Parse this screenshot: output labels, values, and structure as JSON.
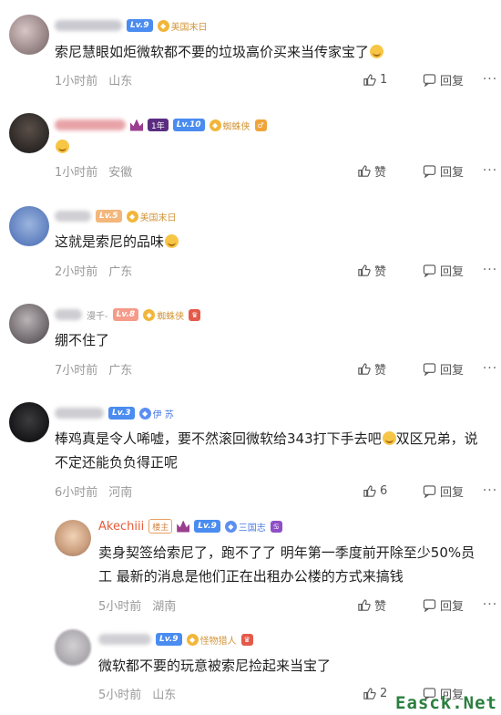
{
  "comments": [
    {
      "name_tail": "",
      "level": "Lv.9",
      "badge": "美国末日",
      "text": "索尼慧眼如炬微软都不要的垃圾高价买来当传家宝了",
      "time": "1小时前",
      "location": "山东",
      "like": "1",
      "reply": "回复"
    },
    {
      "year": "1年",
      "level": "Lv.10",
      "badge": "蜘蛛侠",
      "time": "1小时前",
      "location": "安徽",
      "like": "赞",
      "reply": "回复"
    },
    {
      "level": "Lv.5",
      "badge": "美国末日",
      "text": "这就是索尼的品味",
      "time": "2小时前",
      "location": "广东",
      "like": "赞",
      "reply": "回复"
    },
    {
      "name_tail": "漫千-",
      "level": "Lv.8",
      "badge": "蜘蛛侠",
      "text": "绷不住了",
      "time": "7小时前",
      "location": "广东",
      "like": "赞",
      "reply": "回复"
    },
    {
      "level": "Lv.3",
      "badge": "伊 苏",
      "text_line1": "棒鸡真是令人唏嘘，要不然滚回微软给343打下手去吧",
      "text_line1b": "双区兄弟，说",
      "text_line2": "不定还能负负得正呢",
      "time": "6小时前",
      "location": "河南",
      "like": "6",
      "reply": "回复"
    }
  ],
  "replies": [
    {
      "name": "Akechiii",
      "louzhu": "楼主",
      "level": "Lv.9",
      "badge": "三国志",
      "text_line1": "卖身契签给索尼了，跑不了了 明年第一季度前开除至少50%员",
      "text_line2": "工 最新的消息是他们正在出租办公楼的方式来搞钱",
      "time": "5小时前",
      "location": "湖南",
      "like": "赞",
      "reply": "回复"
    },
    {
      "level": "Lv.9",
      "badge": "怪物猎人",
      "text": "微软都不要的玩意被索尼捡起来当宝了",
      "time": "5小时前",
      "location": "山东",
      "like": "2",
      "reply": "回复"
    }
  ],
  "more_label": "···",
  "watermark": "Easck.Net",
  "colors": {
    "accent_name": "#e65c38",
    "level_blue": "#4a8cf0",
    "meta_gray": "#999999"
  }
}
